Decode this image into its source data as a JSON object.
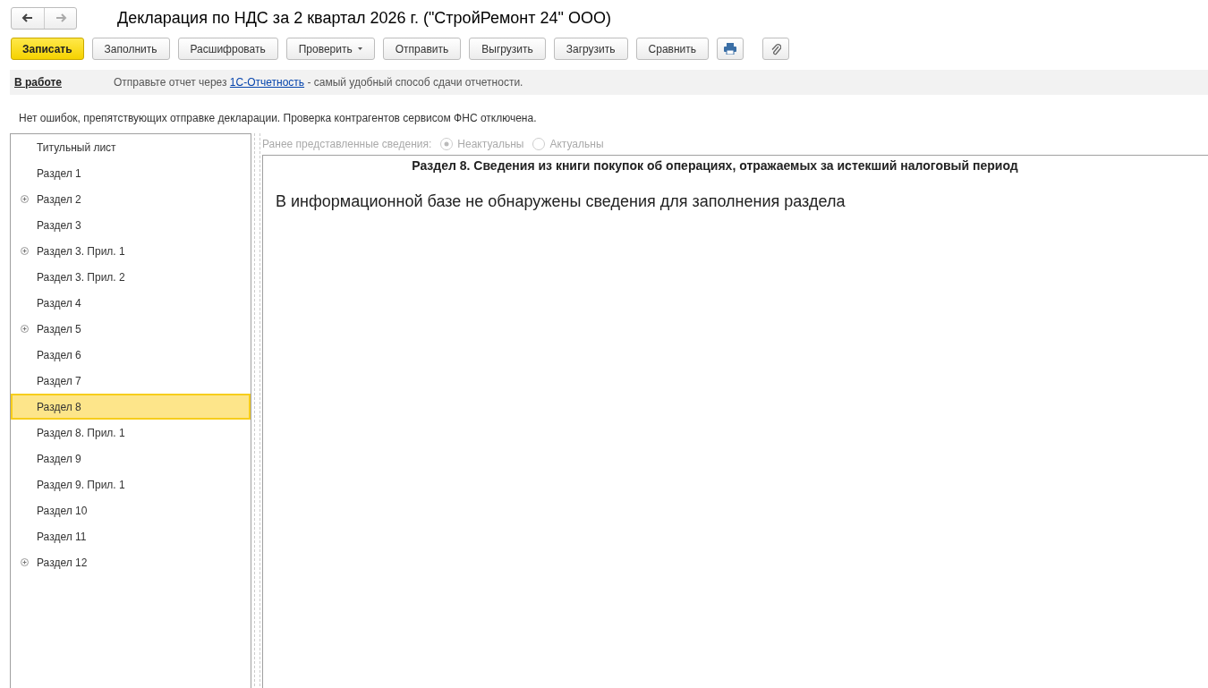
{
  "window": {
    "title": "Декларация по НДС за 2 квартал 2026 г. (\"СтройРемонт 24\" ООО)",
    "nav": [
      {
        "kind": "back",
        "disabled": false
      },
      {
        "kind": "forward",
        "disabled": true
      }
    ]
  },
  "toolbar": [
    {
      "kind": "default",
      "label": "Записать"
    },
    {
      "kind": "plain",
      "label": "Заполнить"
    },
    {
      "kind": "plain",
      "label": "Расшифровать"
    },
    {
      "kind": "dropdown",
      "label": "Проверить"
    },
    {
      "kind": "plain",
      "label": "Отправить"
    },
    {
      "kind": "plain",
      "label": "Выгрузить"
    },
    {
      "kind": "plain",
      "label": "Загрузить"
    },
    {
      "kind": "plain",
      "label": "Сравнить"
    },
    {
      "kind": "print"
    },
    {
      "kind": "attach"
    }
  ],
  "status_bar": {
    "state": "В работе",
    "message_before": "Отправьте отчет через",
    "link": "1С-Отчетность",
    "message_after": "- самый удобный способ сдачи отчетности."
  },
  "check_message": "Нет ошибок, препятствующих отправке декларации. Проверка контрагентов сервисом ФНС отключена.",
  "sections": [
    {
      "label": "Титульный лист",
      "kind": "leaf",
      "selected": false
    },
    {
      "label": "Раздел 1",
      "kind": "leaf",
      "selected": false
    },
    {
      "label": "Раздел 2",
      "kind": "group",
      "selected": false
    },
    {
      "label": "Раздел 3",
      "kind": "leaf",
      "selected": false
    },
    {
      "label": "Раздел 3. Прил. 1",
      "kind": "group",
      "selected": false
    },
    {
      "label": "Раздел 3. Прил. 2",
      "kind": "leaf",
      "selected": false
    },
    {
      "label": "Раздел 4",
      "kind": "leaf",
      "selected": false
    },
    {
      "label": "Раздел 5",
      "kind": "group",
      "selected": false
    },
    {
      "label": "Раздел 6",
      "kind": "leaf",
      "selected": false
    },
    {
      "label": "Раздел 7",
      "kind": "leaf",
      "selected": false
    },
    {
      "label": "Раздел 8",
      "kind": "leaf",
      "selected": true
    },
    {
      "label": "Раздел 8. Прил. 1",
      "kind": "leaf",
      "selected": false
    },
    {
      "label": "Раздел 9",
      "kind": "leaf",
      "selected": false
    },
    {
      "label": "Раздел 9. Прил. 1",
      "kind": "leaf",
      "selected": false
    },
    {
      "label": "Раздел 10",
      "kind": "leaf",
      "selected": false
    },
    {
      "label": "Раздел 11",
      "kind": "leaf",
      "selected": false
    },
    {
      "label": "Раздел 12",
      "kind": "group",
      "selected": false
    }
  ],
  "previous_info": {
    "label": "Ранее представленные сведения:",
    "disabled": true,
    "options": [
      {
        "label": "Неактуальны",
        "selected": true
      },
      {
        "label": "Актуальны",
        "selected": false
      }
    ]
  },
  "report": {
    "heading": "Раздел 8. Сведения из книги покупок об операциях, отражаемых за истекший налоговый период",
    "message": "В информационной базе не обнаружены сведения для заполнения раздела"
  }
}
